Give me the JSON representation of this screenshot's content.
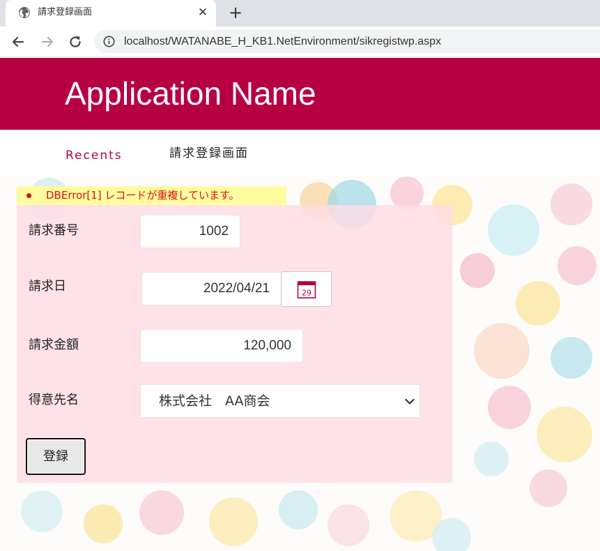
{
  "browser": {
    "tab": {
      "title": "請求登録画面",
      "close": "✕"
    },
    "new_tab": "+",
    "url": "localhost/WATANABE_H_KB1.NetEnvironment/sikregistwp.aspx"
  },
  "header": {
    "app_name": "Application Name",
    "brand_color": "#b70042"
  },
  "nav": {
    "recents": "Recents",
    "current_page": "請求登録画面"
  },
  "error": {
    "message": "DBError[1] レコードが重複しています。",
    "color": "#e01010"
  },
  "form": {
    "invoice_number": {
      "label": "請求番号",
      "value": "1002"
    },
    "invoice_date": {
      "label": "請求日",
      "value": "2022/04/21",
      "calendar_day": "29"
    },
    "invoice_amount": {
      "label": "請求金額",
      "value": "120,000"
    },
    "customer": {
      "label": "得意先名",
      "selected": "株式会社　AA商会"
    },
    "submit_label": "登録"
  }
}
